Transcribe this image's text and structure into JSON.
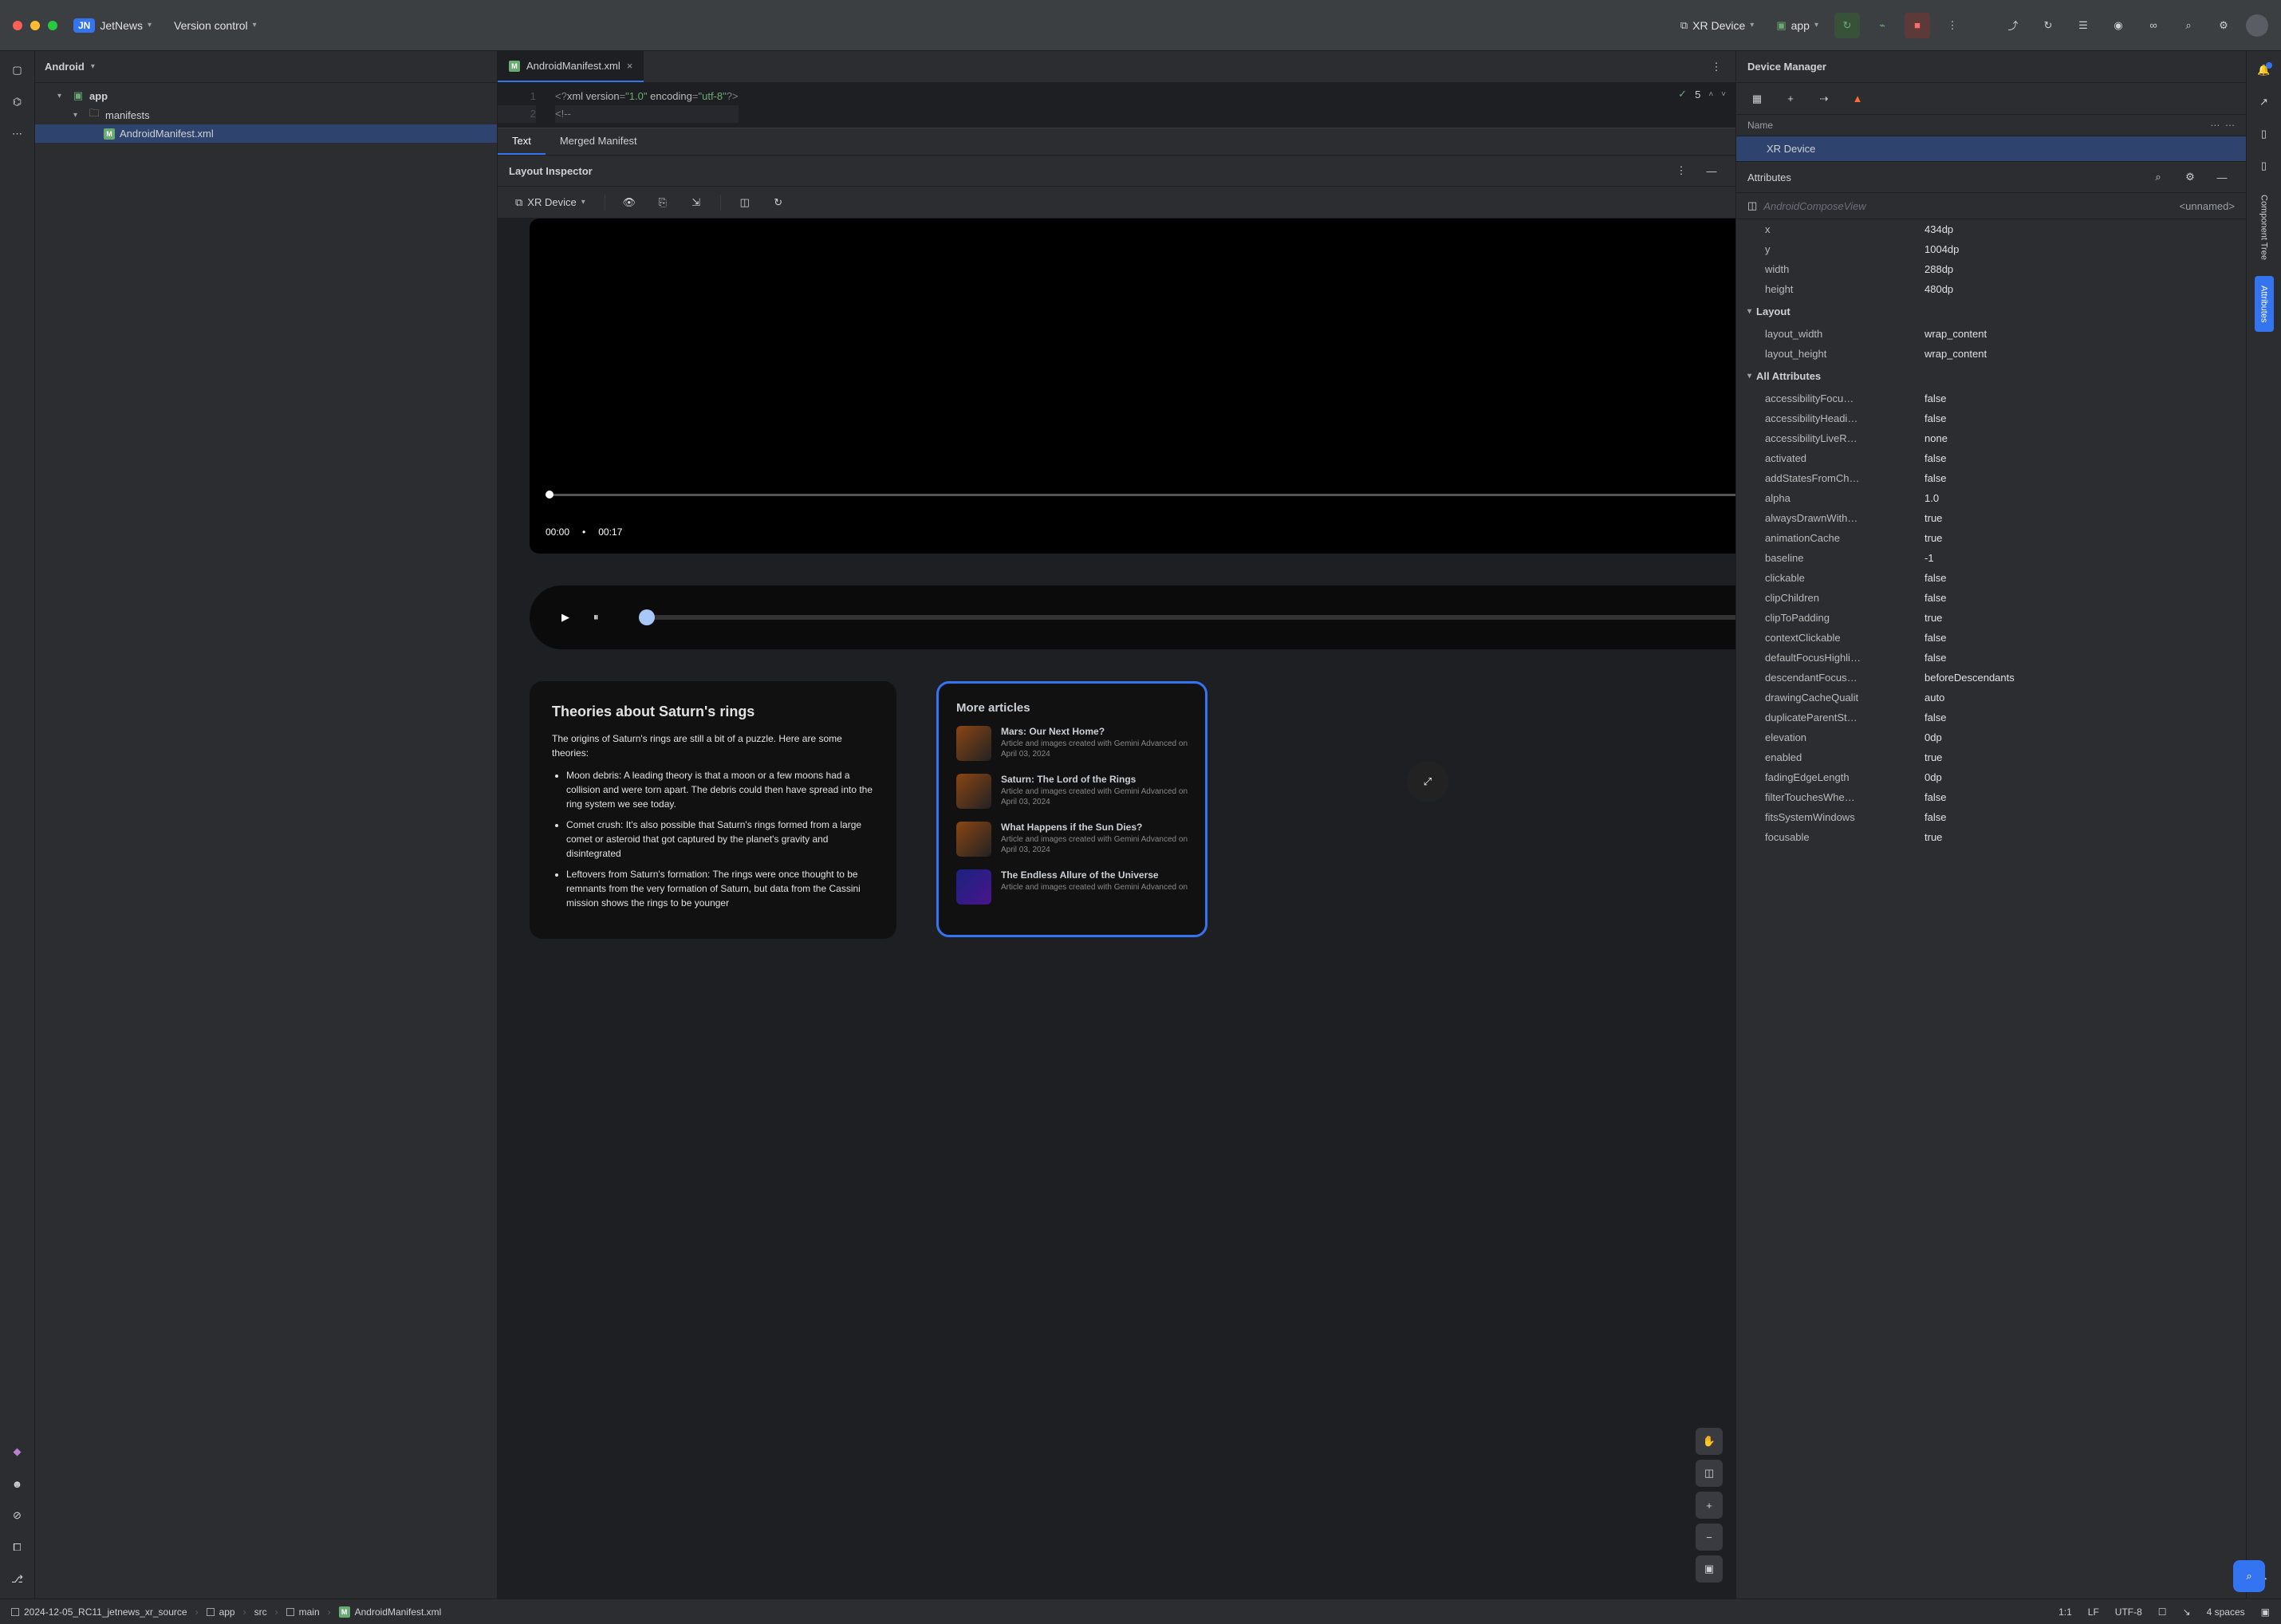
{
  "titlebar": {
    "project_badge": "JN",
    "project_name": "JetNews",
    "version_control": "Version control",
    "run_target": "XR Device",
    "run_config": "app"
  },
  "project_panel": {
    "header": "Android",
    "tree": {
      "app": "app",
      "manifests": "manifests",
      "manifest_file": "AndroidManifest.xml"
    }
  },
  "editor": {
    "tab_file": "AndroidManifest.xml",
    "gutter": [
      "1",
      "2"
    ],
    "line1_raw": "<?xml version=\"1.0\" encoding=\"utf-8\"?>",
    "line1_version": "\"1.0\"",
    "line1_encoding": "\"utf-8\"",
    "line2": "<!--",
    "inspection_count": "5",
    "mini_tabs": {
      "text": "Text",
      "merged": "Merged Manifest"
    }
  },
  "device_manager": {
    "title": "Device Manager",
    "col_name": "Name",
    "row_device": "XR Device"
  },
  "inspector": {
    "title": "Layout Inspector",
    "device": "XR Device"
  },
  "attributes_panel": {
    "title": "Attributes",
    "component": "AndroidComposeView",
    "component_id": "<unnamed>",
    "basic": [
      {
        "k": "x",
        "v": "434dp"
      },
      {
        "k": "y",
        "v": "1004dp"
      },
      {
        "k": "width",
        "v": "288dp"
      },
      {
        "k": "height",
        "v": "480dp"
      }
    ],
    "layout_section": "Layout",
    "layout": [
      {
        "k": "layout_width",
        "v": "wrap_content"
      },
      {
        "k": "layout_height",
        "v": "wrap_content"
      }
    ],
    "all_section": "All Attributes",
    "all": [
      {
        "k": "accessibilityFocu…",
        "v": "false"
      },
      {
        "k": "accessibilityHeadi…",
        "v": "false"
      },
      {
        "k": "accessibilityLiveR…",
        "v": "none"
      },
      {
        "k": "activated",
        "v": "false"
      },
      {
        "k": "addStatesFromCh…",
        "v": "false"
      },
      {
        "k": "alpha",
        "v": "1.0"
      },
      {
        "k": "alwaysDrawnWith…",
        "v": "true"
      },
      {
        "k": "animationCache",
        "v": "true"
      },
      {
        "k": "baseline",
        "v": "-1"
      },
      {
        "k": "clickable",
        "v": "false"
      },
      {
        "k": "clipChildren",
        "v": "false"
      },
      {
        "k": "clipToPadding",
        "v": "true"
      },
      {
        "k": "contextClickable",
        "v": "false"
      },
      {
        "k": "defaultFocusHighli…",
        "v": "false"
      },
      {
        "k": "descendantFocus…",
        "v": "beforeDescendants"
      },
      {
        "k": "drawingCacheQualit",
        "v": "auto"
      },
      {
        "k": "duplicateParentSt…",
        "v": "false"
      },
      {
        "k": "elevation",
        "v": "0dp"
      },
      {
        "k": "enabled",
        "v": "true"
      },
      {
        "k": "fadingEdgeLength",
        "v": "0dp"
      },
      {
        "k": "filterTouchesWhe…",
        "v": "false"
      },
      {
        "k": "fitsSystemWindows",
        "v": "false"
      },
      {
        "k": "focusable",
        "v": "true"
      }
    ]
  },
  "right_strip": {
    "component_tree": "Component Tree",
    "attributes": "Attributes"
  },
  "canvas": {
    "video": {
      "current": "00:00",
      "dot": "•",
      "total": "00:17"
    },
    "theories": {
      "title": "Theories about Saturn's rings",
      "intro": "The origins of Saturn's rings are still a bit of a puzzle. Here are some theories:",
      "bullets": [
        "Moon debris: A leading theory is that a moon or a few moons had a collision and were torn apart. The debris could then have spread into the ring system we see today.",
        "Comet crush: It's also possible that Saturn's rings formed from a large comet or asteroid that got captured by the planet's gravity and disintegrated",
        "Leftovers from Saturn's formation: The rings were once thought to be remnants from the very formation of Saturn, but data from the Cassini mission shows the rings to be younger"
      ]
    },
    "more": {
      "title": "More articles",
      "items": [
        {
          "t": "Mars: Our Next Home?",
          "s": "Article and images created with Gemini Advanced on April 03, 2024"
        },
        {
          "t": "Saturn: The Lord of the Rings",
          "s": "Article and images created with Gemini Advanced on April 03, 2024"
        },
        {
          "t": "What Happens if the Sun Dies?",
          "s": "Article and images created with Gemini Advanced on April 03, 2024"
        },
        {
          "t": "The Endless Allure of the Universe",
          "s": "Article and images created with Gemini Advanced on"
        }
      ]
    }
  },
  "statusbar": {
    "crumbs": [
      "2024-12-05_RC11_jetnews_xr_source",
      "app",
      "src",
      "main",
      "AndroidManifest.xml"
    ],
    "pos": "1:1",
    "le": "LF",
    "enc": "UTF-8",
    "indent": "4 spaces"
  }
}
